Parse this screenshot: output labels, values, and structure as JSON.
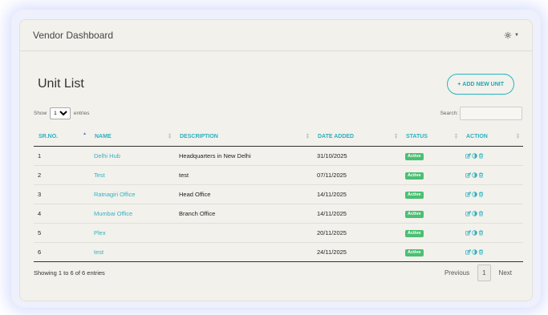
{
  "header": {
    "title": "Vendor Dashboard"
  },
  "page": {
    "title": "Unit List",
    "add_button": "ADD NEW UNIT"
  },
  "controls": {
    "show_label": "Show",
    "entries_label": "entries",
    "page_length": "10",
    "page_length_options": [
      "10"
    ],
    "search_label": "Search:",
    "search_value": ""
  },
  "table": {
    "columns": [
      "SR.NO.",
      "NAME",
      "DESCRIPTION",
      "DATE ADDED",
      "STATUS",
      "ACTION"
    ],
    "rows": [
      {
        "sr": "1",
        "name": "Delhi Hub",
        "description": "Headquarters in New Delhi",
        "date": "31/10/2025",
        "status": "Active"
      },
      {
        "sr": "2",
        "name": "Test",
        "description": "test",
        "date": "07/11/2025",
        "status": "Active"
      },
      {
        "sr": "3",
        "name": "Ratnagiri Office",
        "description": "Head Office",
        "date": "14/11/2025",
        "status": "Active"
      },
      {
        "sr": "4",
        "name": "Mumbai Office",
        "description": "Branch Office",
        "date": "14/11/2025",
        "status": "Active"
      },
      {
        "sr": "5",
        "name": "Plex",
        "description": "",
        "date": "20/11/2025",
        "status": "Active"
      },
      {
        "sr": "6",
        "name": "test",
        "description": "",
        "date": "24/11/2025",
        "status": "Active"
      }
    ]
  },
  "footer": {
    "info": "Showing 1 to 6 of 6 entries",
    "previous": "Previous",
    "current_page": "1",
    "next": "Next"
  },
  "colors": {
    "accent": "#27b5c2",
    "status_active": "#4bbf73",
    "sort_active": "#5a6fd6"
  },
  "icons": [
    "gear-icon",
    "chevron-down-icon",
    "plus-icon",
    "edit-icon",
    "toggle-icon",
    "trash-icon",
    "sort-icon"
  ]
}
